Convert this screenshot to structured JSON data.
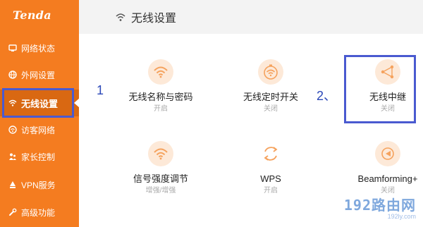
{
  "brand": {
    "logo": "Tenda"
  },
  "sidebar": {
    "items": [
      {
        "label": "网络状态",
        "icon": "network-status-icon"
      },
      {
        "label": "外网设置",
        "icon": "globe-icon"
      },
      {
        "label": "无线设置",
        "icon": "wifi-icon",
        "active": true
      },
      {
        "label": "访客网络",
        "icon": "guest-icon"
      },
      {
        "label": "家长控制",
        "icon": "parental-icon"
      },
      {
        "label": "VPN服务",
        "icon": "vpn-icon"
      },
      {
        "label": "高级功能",
        "icon": "wrench-icon"
      }
    ]
  },
  "header": {
    "title": "无线设置",
    "icon": "wifi-icon"
  },
  "tiles": [
    {
      "name": "无线名称与密码",
      "status": "开启",
      "icon": "wifi-icon"
    },
    {
      "name": "无线定时开关",
      "status": "关闭",
      "icon": "wifi-timer-icon"
    },
    {
      "name": "无线中继",
      "status": "关闭",
      "icon": "relay-icon"
    },
    {
      "name": "信号强度调节",
      "status": "增强/增强",
      "icon": "signal-strength-icon"
    },
    {
      "name": "WPS",
      "status": "开启",
      "icon": "wps-icon"
    },
    {
      "name": "Beamforming+",
      "status": "关闭",
      "icon": "beamforming-icon"
    }
  ],
  "annotations": {
    "n1": "1",
    "n2": "2、"
  },
  "watermark": {
    "main": "192路由网",
    "sub": "192ly.com"
  },
  "colors": {
    "brand": "#f47c20",
    "active": "#d96812",
    "highlight": "#4a5ad0",
    "icon_bg": "#fde9d8",
    "icon_fg": "#f5a25d"
  }
}
